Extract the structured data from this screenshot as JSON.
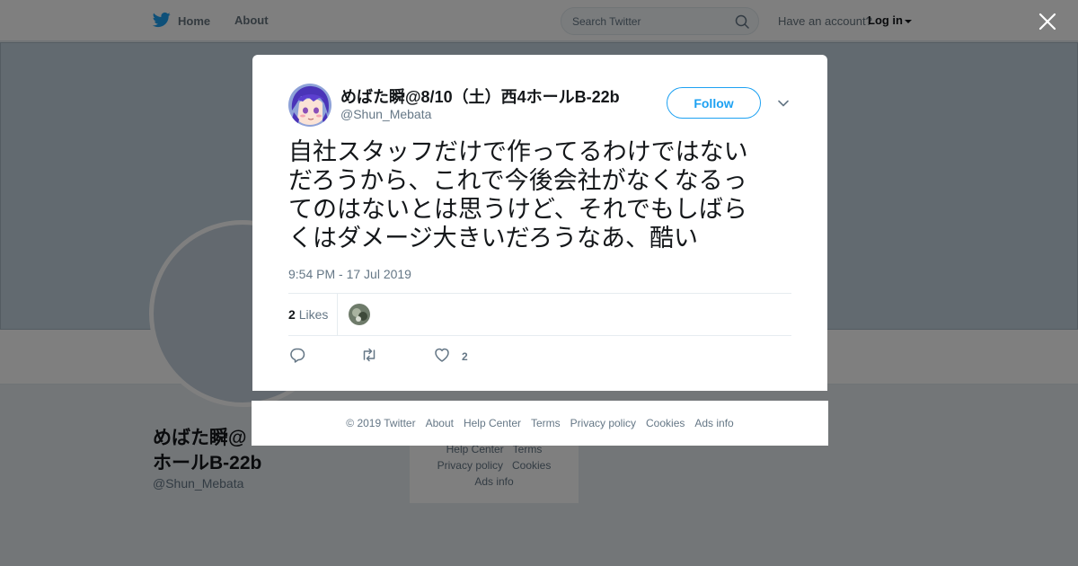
{
  "topbar": {
    "home_label": "Home",
    "about_label": "About",
    "search_placeholder": "Search Twitter",
    "account_prompt": "Have an account?",
    "login_label": "Log in"
  },
  "profile": {
    "name_line1": "めばた瞬@",
    "name_line2": "ホールB-22b",
    "handle": "@Shun_Mebata"
  },
  "side_footer": {
    "row1": [
      "Help Center",
      "Terms"
    ],
    "row2": [
      "Privacy policy",
      "Cookies"
    ],
    "row3": [
      "Ads info"
    ]
  },
  "tweet": {
    "author_name": "めばた瞬@8/10（土）西4ホールB-22b",
    "author_handle": "@Shun_Mebata",
    "follow_label": "Follow",
    "text_lines": [
      "自社スタッフだけで作ってるわけではない",
      "だろうから、これで今後会社がなくなるっ",
      "てのはないとは思うけど、それでもしばら",
      "くはダメージ大きいだろうなあ、酷い"
    ],
    "timestamp": "9:54 PM - 17 Jul 2019",
    "likes_count": "2",
    "likes_label": "Likes",
    "like_action_count": "2"
  },
  "footer": {
    "links": [
      "© 2019 Twitter",
      "About",
      "Help Center",
      "Terms",
      "Privacy policy",
      "Cookies",
      "Ads info"
    ]
  },
  "colors": {
    "accent": "#1da1f2",
    "muted_text": "#657786",
    "overlay": "rgba(0,0,0,0.5)"
  }
}
